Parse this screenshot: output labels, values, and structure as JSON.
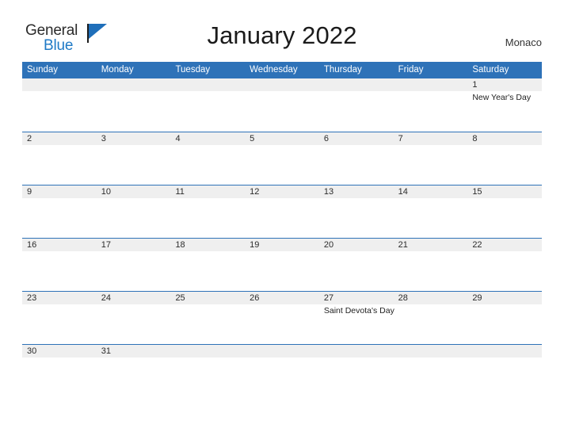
{
  "brand": {
    "name_part1": "General",
    "name_part2": "Blue",
    "flag_icon": "blue-triangle-flag-icon",
    "color_dark": "#2b2b2b",
    "color_blue": "#1f7ac6"
  },
  "header": {
    "title": "January 2022",
    "region": "Monaco"
  },
  "theme": {
    "header_blue": "#2e72b8",
    "band_gray": "#efefef",
    "page_background": "#ffffff",
    "text_dark": "#2b2b2b"
  },
  "calendar": {
    "month": "January",
    "year": "2022",
    "weekdays": [
      "Sunday",
      "Monday",
      "Tuesday",
      "Wednesday",
      "Thursday",
      "Friday",
      "Saturday"
    ],
    "weeks": [
      [
        {
          "date": "",
          "event": ""
        },
        {
          "date": "",
          "event": ""
        },
        {
          "date": "",
          "event": ""
        },
        {
          "date": "",
          "event": ""
        },
        {
          "date": "",
          "event": ""
        },
        {
          "date": "",
          "event": ""
        },
        {
          "date": "1",
          "event": "New Year's Day"
        }
      ],
      [
        {
          "date": "2",
          "event": ""
        },
        {
          "date": "3",
          "event": ""
        },
        {
          "date": "4",
          "event": ""
        },
        {
          "date": "5",
          "event": ""
        },
        {
          "date": "6",
          "event": ""
        },
        {
          "date": "7",
          "event": ""
        },
        {
          "date": "8",
          "event": ""
        }
      ],
      [
        {
          "date": "9",
          "event": ""
        },
        {
          "date": "10",
          "event": ""
        },
        {
          "date": "11",
          "event": ""
        },
        {
          "date": "12",
          "event": ""
        },
        {
          "date": "13",
          "event": ""
        },
        {
          "date": "14",
          "event": ""
        },
        {
          "date": "15",
          "event": ""
        }
      ],
      [
        {
          "date": "16",
          "event": ""
        },
        {
          "date": "17",
          "event": ""
        },
        {
          "date": "18",
          "event": ""
        },
        {
          "date": "19",
          "event": ""
        },
        {
          "date": "20",
          "event": ""
        },
        {
          "date": "21",
          "event": ""
        },
        {
          "date": "22",
          "event": ""
        }
      ],
      [
        {
          "date": "23",
          "event": ""
        },
        {
          "date": "24",
          "event": ""
        },
        {
          "date": "25",
          "event": ""
        },
        {
          "date": "26",
          "event": ""
        },
        {
          "date": "27",
          "event": "Saint Devota's Day"
        },
        {
          "date": "28",
          "event": ""
        },
        {
          "date": "29",
          "event": ""
        }
      ],
      [
        {
          "date": "30",
          "event": ""
        },
        {
          "date": "31",
          "event": ""
        },
        {
          "date": "",
          "event": ""
        },
        {
          "date": "",
          "event": ""
        },
        {
          "date": "",
          "event": ""
        },
        {
          "date": "",
          "event": ""
        },
        {
          "date": "",
          "event": ""
        }
      ]
    ]
  }
}
